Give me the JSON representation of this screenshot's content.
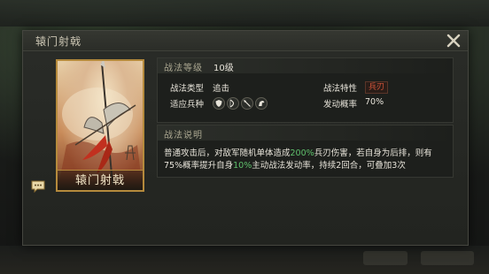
{
  "dialog": {
    "title": "辕门射戟"
  },
  "card": {
    "name": "辕门射戟"
  },
  "level_section": {
    "label": "战法等级",
    "level": "10级",
    "type_label": "战法类型",
    "type_value": "追击",
    "trait_label": "战法特性",
    "trait_value": "兵刃",
    "troops_label": "适应兵种",
    "troop_icons": [
      "shield-icon",
      "bow-icon",
      "spear-icon",
      "horse-icon"
    ],
    "rate_label": "发动概率",
    "rate_value": "70%"
  },
  "desc_section": {
    "label": "战法说明",
    "text_1": "普通攻击后，对敌军随机单体造成",
    "pct_1": "200%",
    "text_2": "兵刃伤害，若自身为后排，则有75%概率提升自身",
    "pct_2": "10%",
    "text_3": "主动战法发动率，持续2回合，可叠加3次"
  },
  "colors": {
    "highlight": "#5fc06c",
    "trait": "#d4553a",
    "card_border": "#b58a3c"
  }
}
